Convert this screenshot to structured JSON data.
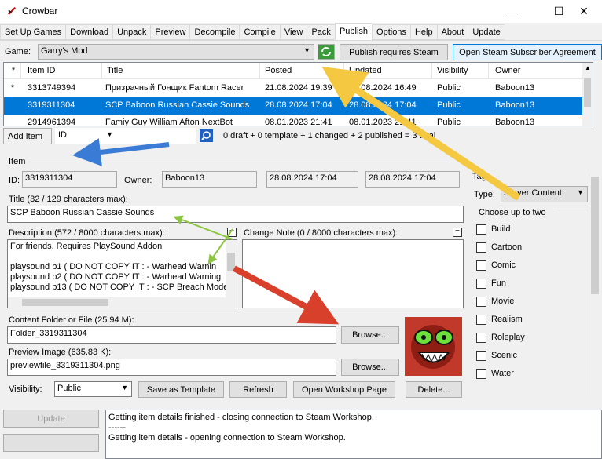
{
  "app": {
    "title": "Crowbar",
    "min": "—",
    "max": "☐",
    "close": "✕"
  },
  "tabs": [
    "Set Up Games",
    "Download",
    "Unpack",
    "Preview",
    "Decompile",
    "Compile",
    "View",
    "Pack",
    "Publish",
    "Options",
    "Help",
    "About",
    "Update"
  ],
  "active_tab": "Publish",
  "game": {
    "label": "Game:",
    "value": "Garry's Mod",
    "refresh_icon": "refresh-icon",
    "requires_steam": "Publish requires Steam",
    "open_agreement": "Open Steam Subscriber Agreement"
  },
  "grid": {
    "headers": [
      "*",
      "Item ID",
      "Title",
      "Posted",
      "Updated",
      "Visibility",
      "Owner"
    ],
    "rows": [
      {
        "mark": "*",
        "id": "3313749394",
        "title": "Призрачный Гонщик Fantom Racer",
        "posted": "21.08.2024 19:39",
        "updated": "21.08.2024 16:49",
        "visibility": "Public",
        "owner": "Baboon13"
      },
      {
        "mark": "",
        "id": "3319311304",
        "title": "SCP Baboon Russian Cassie Sounds",
        "posted": "28.08.2024 17:04",
        "updated": "28.08.2024 17:04",
        "visibility": "Public",
        "owner": "Baboon13"
      },
      {
        "mark": "",
        "id": "2914961394",
        "title": "Famiy Guy William Afton NextBot",
        "posted": "08.01.2023 21:41",
        "updated": "08.01.2023 21:41",
        "visibility": "Public",
        "owner": "Baboon13"
      }
    ]
  },
  "toolbar": {
    "add_item": "Add Item",
    "search_field": "ID",
    "status": "0 draft + 0 template + 1 changed + 2 published = 3 total"
  },
  "item": {
    "group": "Item",
    "id_label": "ID:",
    "id": "3319311304",
    "owner_label": "Owner:",
    "owner": "Baboon13",
    "posted": "28.08.2024 17:04",
    "updated": "28.08.2024 17:04",
    "title_label": "Title (32 / 129 characters max):",
    "title": "SCP Baboon Russian Cassie Sounds",
    "desc_label": "Description (572 / 8000 characters max):",
    "desc_lines": [
      "For friends. Requires PlaySound Addon",
      "",
      "playsound b1 ( DO NOT COPY IT : - Warhead  Warnin",
      "playsound b2 ( DO NOT COPY IT : - Warhead Warning",
      "playsound b13 ( DO NOT COPY IT : - SCP Breach Mode"
    ],
    "note_label": "Change Note (0 / 8000 characters max):",
    "content_label": "Content Folder or File (25.94 M):",
    "content": "Folder_3319311304",
    "preview_label": "Preview Image (635.83 K):",
    "preview": "previewfile_3319311304.png",
    "browse": "Browse...",
    "visibility_label": "Visibility:",
    "visibility": "Public",
    "save_template": "Save as Template",
    "refresh": "Refresh",
    "open_workshop": "Open Workshop Page",
    "delete": "Delete..."
  },
  "tags": {
    "group": "Tags",
    "type_label": "Type:",
    "type": "Server Content",
    "choose": "Choose up to two",
    "items": [
      "Build",
      "Cartoon",
      "Comic",
      "Fun",
      "Movie",
      "Realism",
      "Roleplay",
      "Scenic",
      "Water"
    ]
  },
  "bottom": {
    "update": "Update",
    "log": [
      "Getting item details finished - closing connection to Steam Workshop.",
      "------",
      "Getting item details - opening connection to Steam Workshop."
    ]
  },
  "colors": {
    "selection": "#0078d7",
    "arrow_yellow": "#f5c842",
    "arrow_blue": "#3a7bd5",
    "arrow_red": "#d9402c",
    "arrow_green": "#8cc63f"
  }
}
